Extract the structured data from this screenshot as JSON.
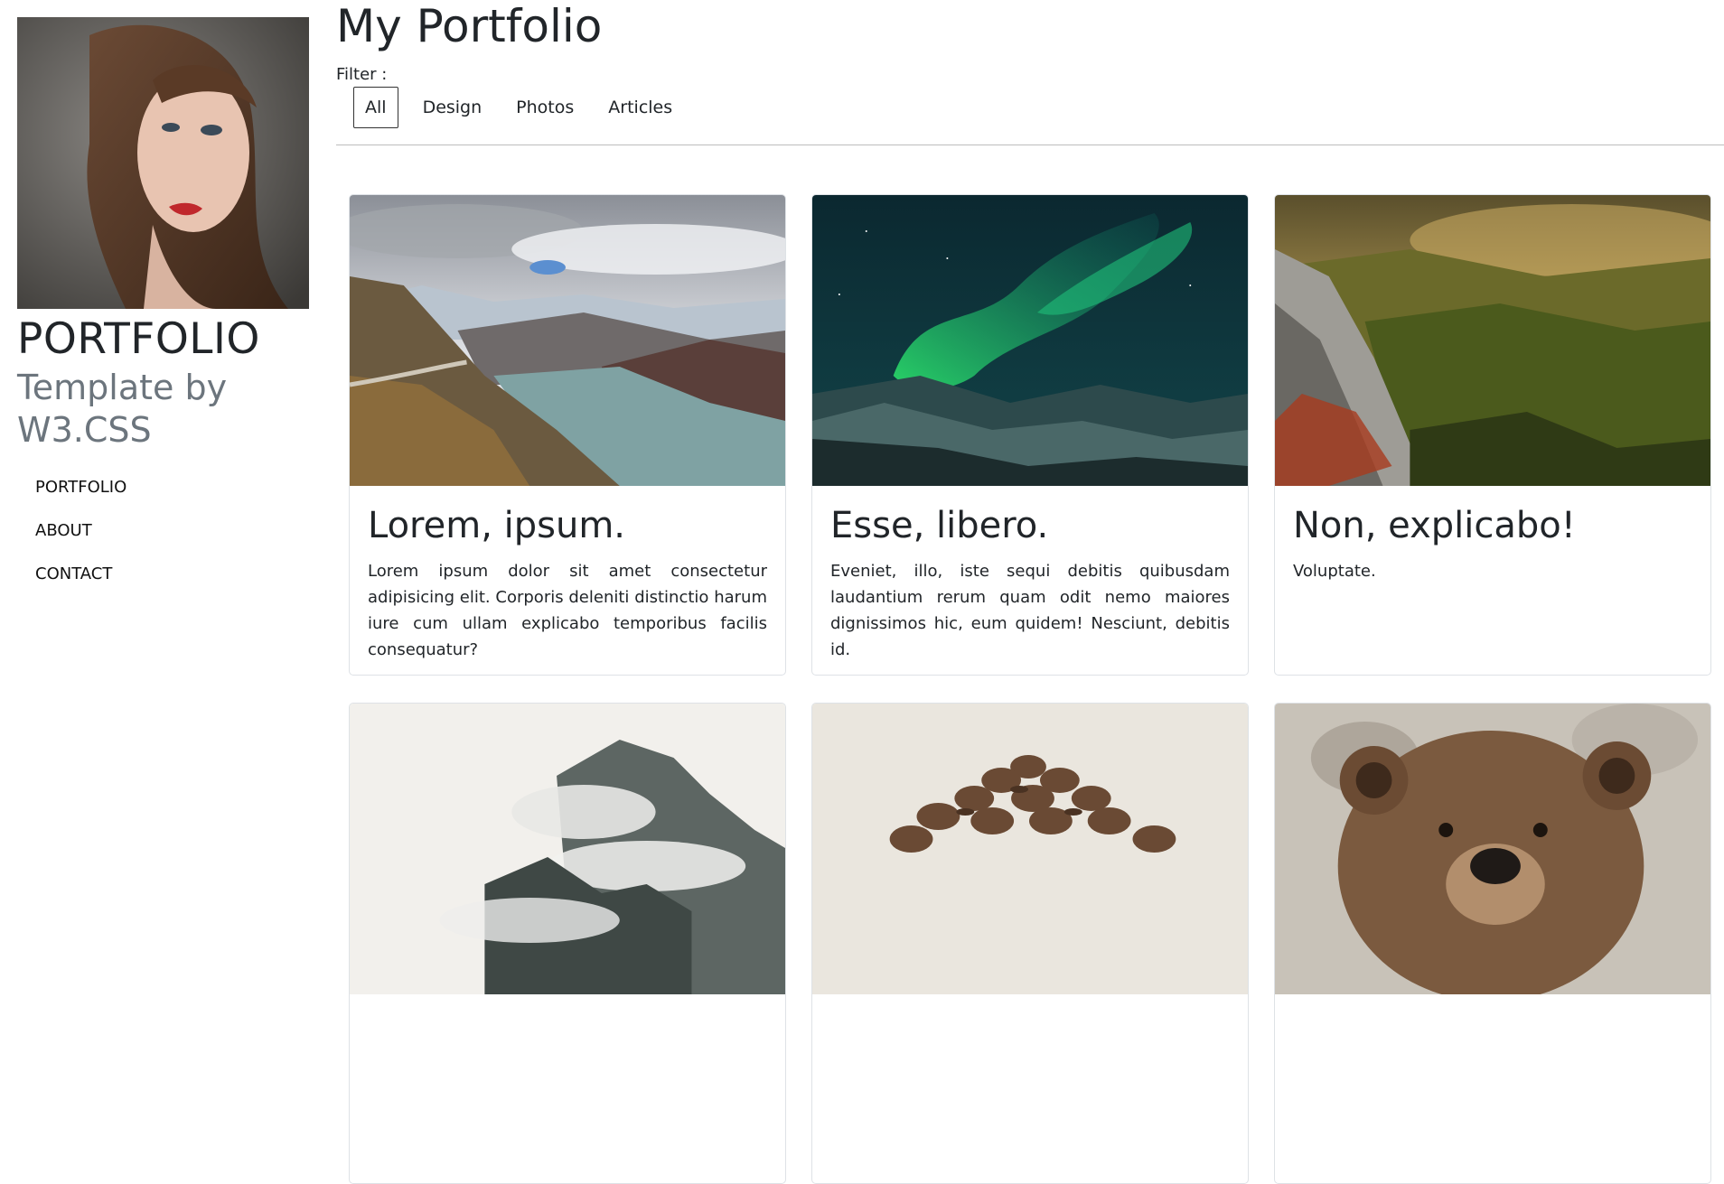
{
  "sidebar": {
    "brand": "PORTFOLIO",
    "tagline": "Template by W3.CSS",
    "nav": [
      {
        "label": "PORTFOLIO"
      },
      {
        "label": "ABOUT"
      },
      {
        "label": "CONTACT"
      }
    ]
  },
  "main": {
    "title": "My Portfolio",
    "filter_label": "Filter :",
    "filters": [
      {
        "label": "All",
        "active": true
      },
      {
        "label": "Design"
      },
      {
        "label": "Photos"
      },
      {
        "label": "Articles"
      }
    ],
    "cards": [
      {
        "title": "Lorem, ipsum.",
        "text": "Lorem ipsum dolor sit amet consectetur adipisicing elit. Corporis deleniti distinctio harum iure cum ullam explicabo temporibus facilis consequatur?",
        "image": "mountain-lake-road"
      },
      {
        "title": "Esse, libero.",
        "text": "Eveniet, illo, iste sequi debitis quibusdam laudantium rerum quam odit nemo maiores dignissimos hic, eum quidem! Nesciunt, debitis id.",
        "image": "aurora-borealis"
      },
      {
        "title": "Non, explicabo!",
        "text": "Voluptate.",
        "image": "forest-valley-cliff"
      },
      {
        "title": "",
        "text": "",
        "image": "misty-mountain"
      },
      {
        "title": "",
        "text": "",
        "image": "coffee-beans"
      },
      {
        "title": "",
        "text": "",
        "image": "brown-bear"
      }
    ]
  },
  "colors": {
    "text": "#212529",
    "muted": "#6c757d",
    "border": "#dee2e6"
  }
}
